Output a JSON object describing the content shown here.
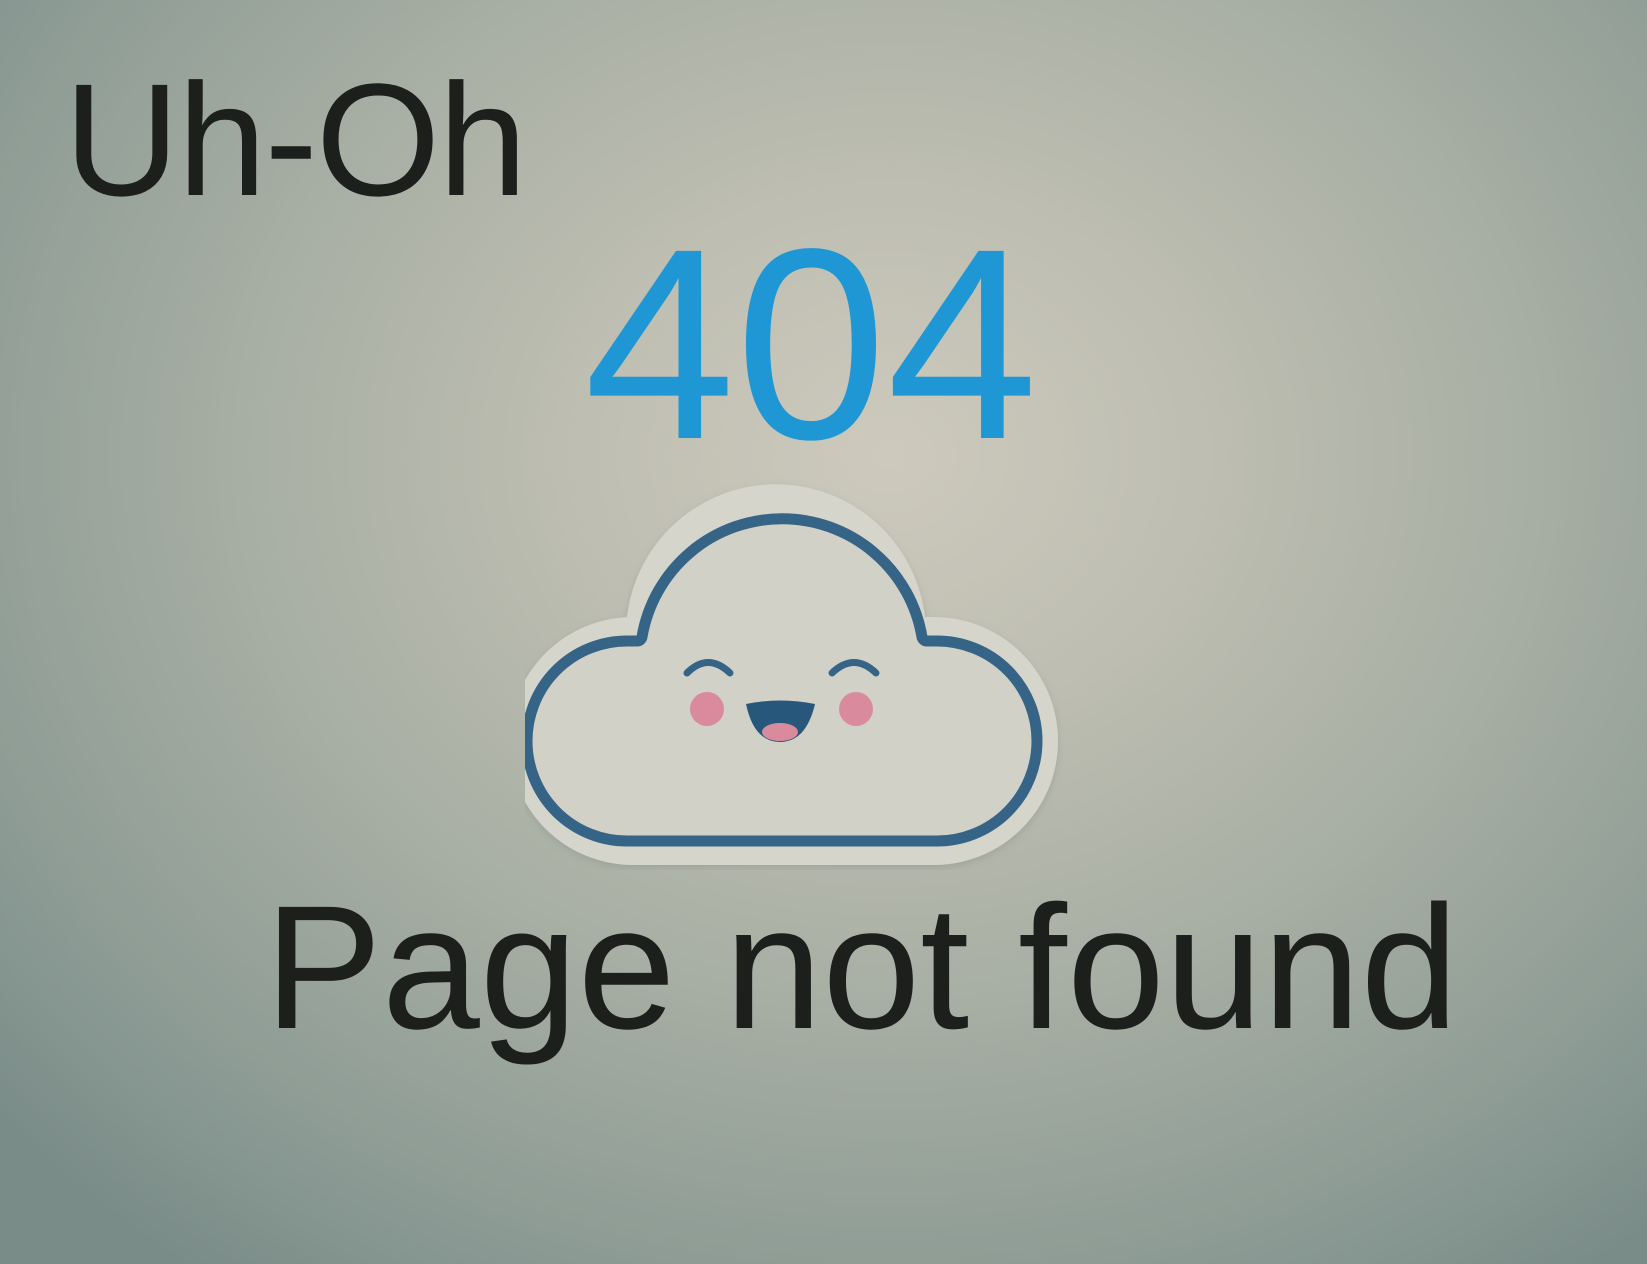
{
  "error_page": {
    "heading": "Uh-Oh",
    "code": "404",
    "message": "Page not found",
    "illustration_icon": "smiling-cloud-icon",
    "colors": {
      "code": "#1e97d4",
      "cloud_outline": "#356486",
      "cheeks": "#d98a9c",
      "text": "#1d1f1c"
    }
  }
}
